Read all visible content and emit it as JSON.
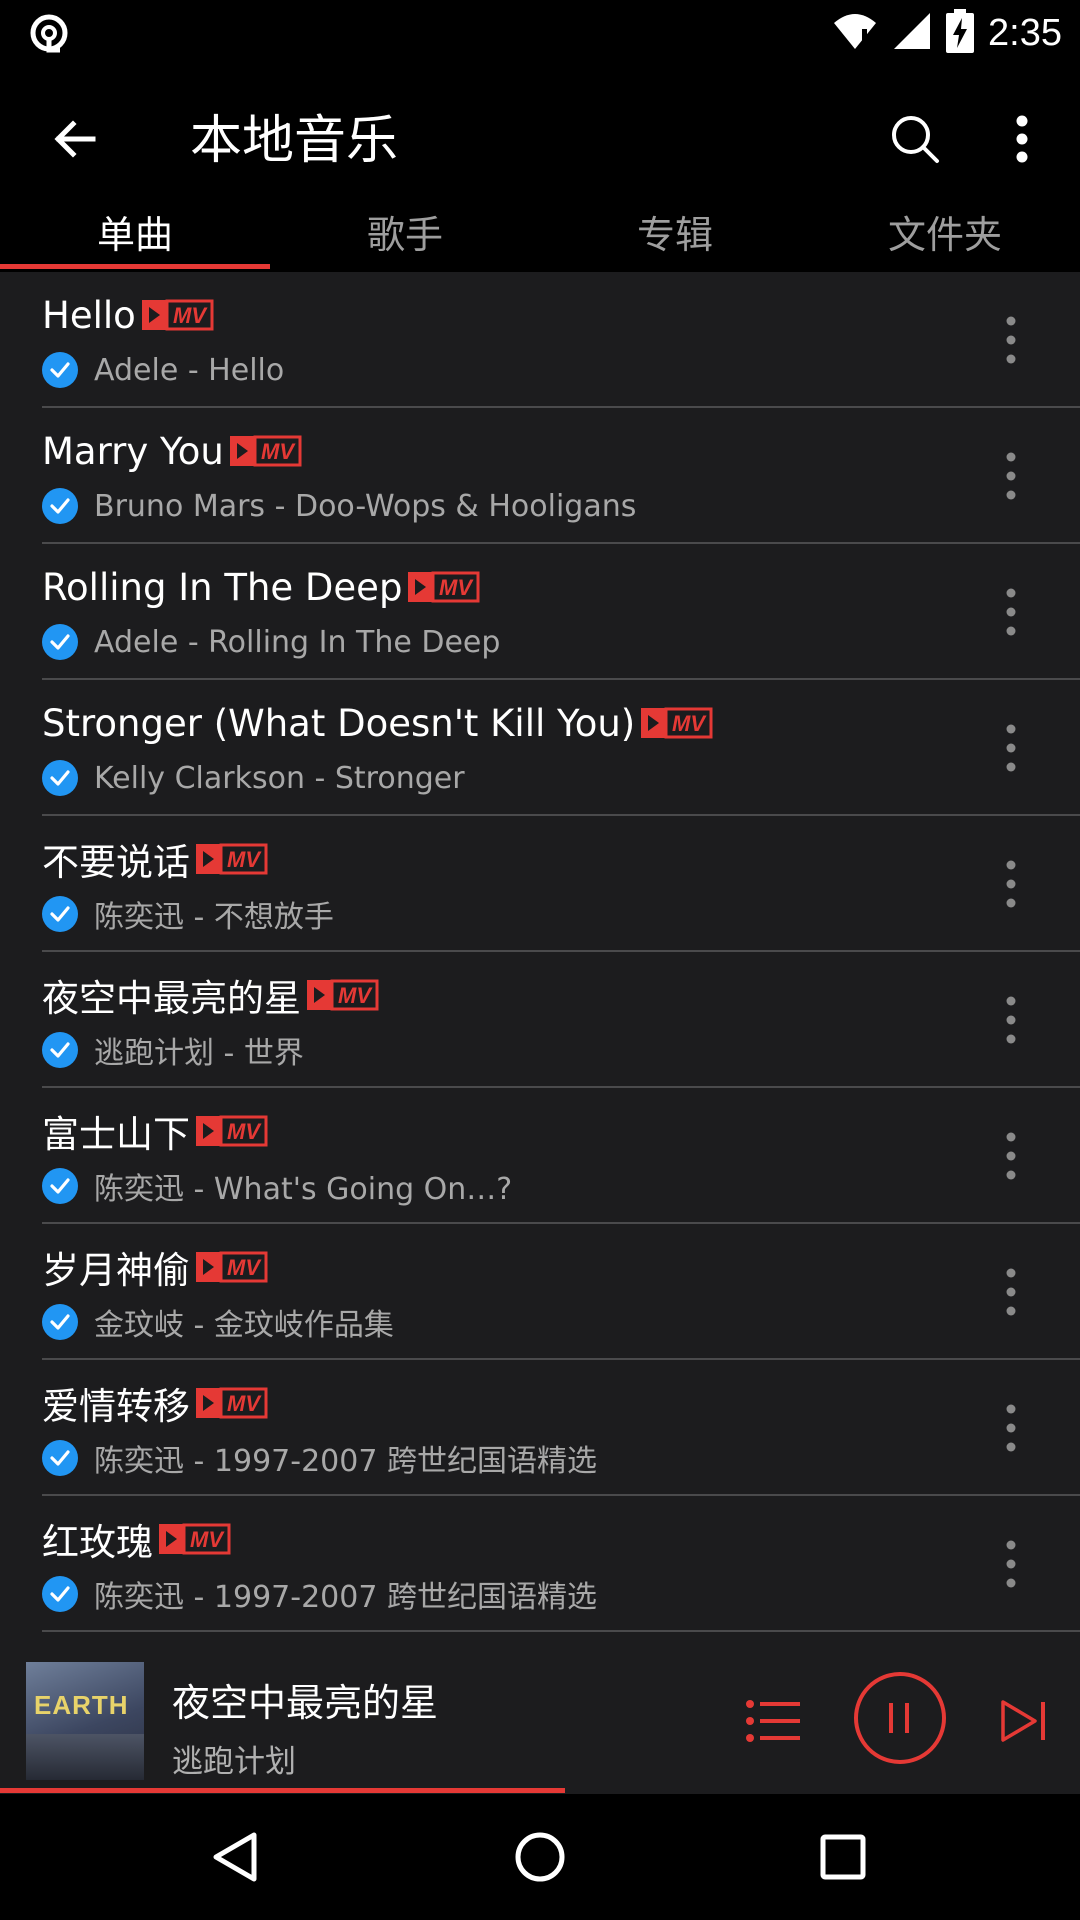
{
  "status_bar": {
    "time": "2:35"
  },
  "app_bar": {
    "title": "本地音乐"
  },
  "tabs": [
    {
      "label": "单曲",
      "active": true
    },
    {
      "label": "歌手",
      "active": false
    },
    {
      "label": "专辑",
      "active": false
    },
    {
      "label": "文件夹",
      "active": false
    }
  ],
  "songs": [
    {
      "title": "Hello",
      "subtitle": "Adele - Hello"
    },
    {
      "title": "Marry You",
      "subtitle": "Bruno Mars - Doo-Wops & Hooligans"
    },
    {
      "title": "Rolling In The Deep",
      "subtitle": "Adele - Rolling In The Deep"
    },
    {
      "title": "Stronger (What Doesn't Kill You)",
      "subtitle": "Kelly Clarkson - Stronger"
    },
    {
      "title": "不要说话",
      "subtitle": "陈奕迅 - 不想放手"
    },
    {
      "title": "夜空中最亮的星",
      "subtitle": "逃跑计划 - 世界"
    },
    {
      "title": "富士山下",
      "subtitle": "陈奕迅 - What's Going On…?"
    },
    {
      "title": "岁月神偷",
      "subtitle": "金玟岐 - 金玟岐作品集"
    },
    {
      "title": "爱情转移",
      "subtitle": "陈奕迅 - 1997-2007 跨世纪国语精选"
    },
    {
      "title": "红玫瑰",
      "subtitle": "陈奕迅 - 1997-2007 跨世纪国语精选"
    }
  ],
  "mv_badge": "MV",
  "now_playing": {
    "title": "夜空中最亮的星",
    "artist": "逃跑计划",
    "cover_text": "EARTH",
    "progress": 0.523
  },
  "colors": {
    "accent": "#e53935",
    "check": "#2196f3",
    "background": "#1c1c1e"
  }
}
